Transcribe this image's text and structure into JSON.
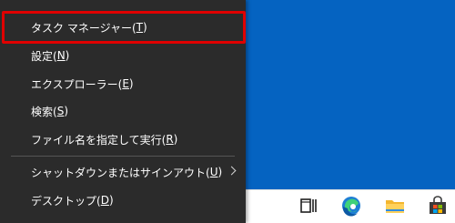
{
  "menu": {
    "items": [
      {
        "label": "タスク マネージャー(",
        "key": "T",
        "suffix": ")"
      },
      {
        "label": "設定(",
        "key": "N",
        "suffix": ")"
      },
      {
        "label": "エクスプローラー(",
        "key": "E",
        "suffix": ")"
      },
      {
        "label": "検索(",
        "key": "S",
        "suffix": ")"
      },
      {
        "label": "ファイル名を指定して実行(",
        "key": "R",
        "suffix": ")"
      },
      {
        "label": "シャットダウンまたはサインアウト(",
        "key": "U",
        "suffix": ")"
      },
      {
        "label": "デスクトップ(",
        "key": "D",
        "suffix": ")"
      }
    ]
  },
  "taskbar": {
    "icons": [
      "task-view-icon",
      "edge-icon",
      "file-explorer-icon",
      "microsoft-store-icon"
    ]
  },
  "colors": {
    "desktop": "#0563c1",
    "menu_bg": "#2b2b2b",
    "highlight": "#e00000",
    "taskbar": "#ffffff"
  }
}
